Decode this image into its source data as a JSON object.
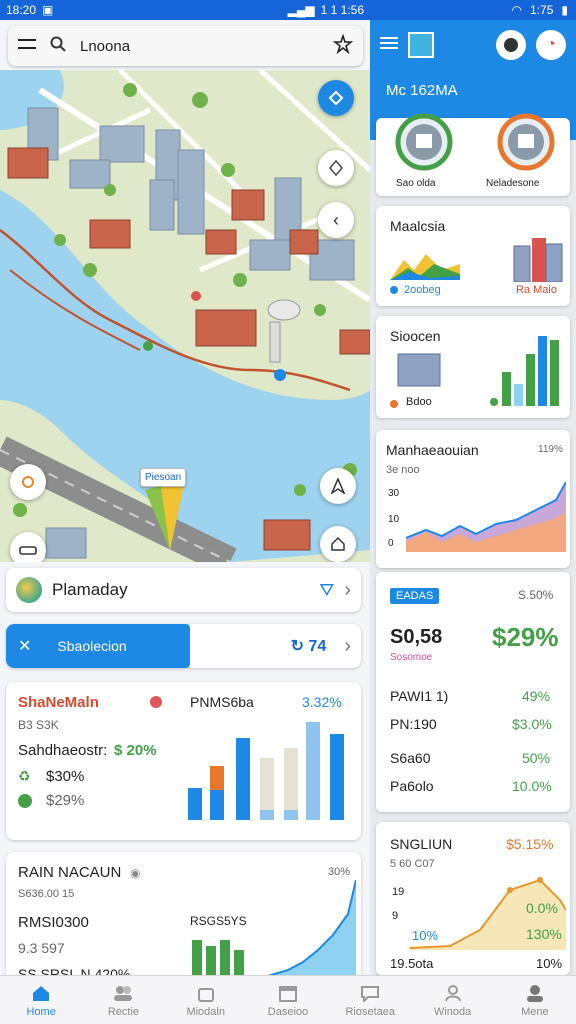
{
  "status_bar": {
    "time_left": "18:20",
    "time_right": "1:75",
    "time_mid": "1 1 1:56"
  },
  "search": {
    "query": "Lnoona"
  },
  "map": {
    "marker_label": "Piesoan"
  },
  "place": {
    "name": "Plamaday"
  },
  "route": {
    "button_label": "Sbaolecion",
    "value": "74"
  },
  "stats_card": {
    "title": "ShaNeMaln",
    "subtitle": "B3 S3K",
    "label": "Sahdhaeostr:",
    "pct": "$ 20%",
    "row1_value": "$30%",
    "row2_value": "$29%",
    "chart_title": "PNMS6ba",
    "chart_pct": "3.32%"
  },
  "trend_card": {
    "title": "RAIN NACAUN",
    "corner_value": "30%",
    "sub": "S636.00 15",
    "label": "RMSI0300",
    "line1": "9.3 597",
    "line2": "SS SRSL N 420%",
    "chart_label": "RSGS5YS"
  },
  "right_panel": {
    "header_title": "Mc 162MA",
    "gauge_left_label": "Sao olda",
    "gauge_right_label": "Neladesone",
    "card1": {
      "title": "Maalcsia",
      "left_label": "2oobeg",
      "right_label": "Ra Maio"
    },
    "card2": {
      "title": "Sioocen",
      "tag": "Bdoo"
    },
    "card3": {
      "title": "Manhaeaouian",
      "corner": "119%",
      "sub": "3e noo",
      "y_labels": [
        "30",
        "10",
        "0"
      ]
    },
    "card4": {
      "tag": "EADAS",
      "corner": "S.50%",
      "amount": "S0,58",
      "amount_sub": "Sosomoe",
      "big_pct": "$29%",
      "rows": [
        {
          "label": "PAWI1 1)",
          "value": "49%"
        },
        {
          "label": "PN:190",
          "value": "$3.0%"
        },
        {
          "label": "S6a60",
          "value": "50%"
        },
        {
          "label": "Pa6olo",
          "value": "10.0%"
        }
      ]
    },
    "card5": {
      "title": "SNGLIUN",
      "corner": "$5.15%",
      "sub": "5 60 C07",
      "y_labels": [
        "19",
        "9"
      ],
      "pct_left": "10%",
      "pct_right_top": "0.0%",
      "pct_right_bottom": "130%",
      "footer_left": "19.5ota",
      "footer_right": "10%"
    }
  },
  "bottom_nav": [
    {
      "label": "Home",
      "icon": "home-icon"
    },
    {
      "label": "Rectie",
      "icon": "people-icon"
    },
    {
      "label": "Miodaln",
      "icon": "bag-icon"
    },
    {
      "label": "Daseioo",
      "icon": "calendar-icon"
    },
    {
      "label": "Riosetaea",
      "icon": "chat-icon"
    },
    {
      "label": "Winoda",
      "icon": "user-icon"
    },
    {
      "label": "Mene",
      "icon": "profile-icon"
    }
  ]
}
